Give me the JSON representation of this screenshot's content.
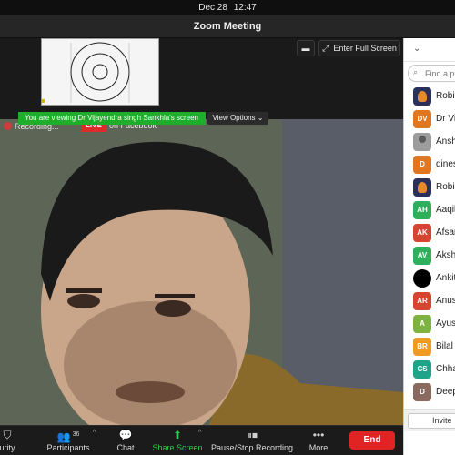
{
  "menubar": {
    "date": "Dec 28",
    "time": "12:47"
  },
  "window": {
    "title": "Zoom Meeting"
  },
  "top_controls": {
    "fullscreen_label": "Enter Full Screen"
  },
  "share_banner": {
    "text": "You are viewing Dr Vijayendra singh Sankhla's screen",
    "view_options_label": "View Options"
  },
  "video": {
    "recording_label": "Recording...",
    "live_badge": "LIVE",
    "live_target": "on Facebook"
  },
  "controls": {
    "security_label": "urity",
    "participants_label": "Participants",
    "participants_count": "36",
    "chat_label": "Chat",
    "share_label": "Share Screen",
    "recording_label": "Pause/Stop Recording",
    "more_label": "More",
    "end_label": "End"
  },
  "sidebar": {
    "search_placeholder": "Find a p",
    "invite_label": "Invite",
    "participants": [
      {
        "name": "Robin",
        "avatar_text": "",
        "avatar_style": "img-logo",
        "color": ""
      },
      {
        "name": "Dr Vij",
        "avatar_text": "DV",
        "avatar_style": "",
        "color": "#e0761f"
      },
      {
        "name": "Ansh",
        "avatar_text": "",
        "avatar_style": "img-photo",
        "color": ""
      },
      {
        "name": "dines",
        "avatar_text": "D",
        "avatar_style": "",
        "color": "#e0761f"
      },
      {
        "name": "Robin",
        "avatar_text": "",
        "avatar_style": "img-logo",
        "color": ""
      },
      {
        "name": "Aaqib",
        "avatar_text": "AH",
        "avatar_style": "",
        "color": "#2fae5c"
      },
      {
        "name": "Afsan",
        "avatar_text": "AK",
        "avatar_style": "",
        "color": "#d64532"
      },
      {
        "name": "Akshi",
        "avatar_text": "AV",
        "avatar_style": "",
        "color": "#2fae5c"
      },
      {
        "name": "Ankit",
        "avatar_text": "",
        "avatar_style": "img-black",
        "color": ""
      },
      {
        "name": "Anus",
        "avatar_text": "AR",
        "avatar_style": "",
        "color": "#d64532"
      },
      {
        "name": "Ayush",
        "avatar_text": "A",
        "avatar_style": "",
        "color": "#7fb33f"
      },
      {
        "name": "Bilal",
        "avatar_text": "BR",
        "avatar_style": "",
        "color": "#f09a22"
      },
      {
        "name": "Chha",
        "avatar_text": "CS",
        "avatar_style": "",
        "color": "#1fa48a"
      },
      {
        "name": "Deep",
        "avatar_text": "D",
        "avatar_style": "img-deep",
        "color": ""
      }
    ]
  }
}
